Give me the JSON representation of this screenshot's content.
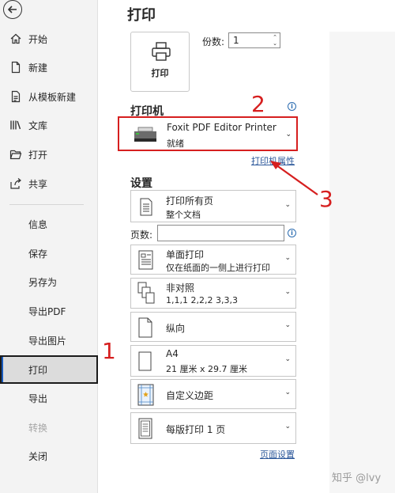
{
  "sidebar": {
    "items": [
      {
        "label": "开始",
        "icon": "home-icon"
      },
      {
        "label": "新建",
        "icon": "new-doc-icon"
      },
      {
        "label": "从模板新建",
        "icon": "template-icon"
      },
      {
        "label": "文库",
        "icon": "library-icon"
      },
      {
        "label": "打开",
        "icon": "folder-open-icon"
      },
      {
        "label": "共享",
        "icon": "share-icon"
      }
    ],
    "sub_items": [
      {
        "label": "信息"
      },
      {
        "label": "保存"
      },
      {
        "label": "另存为"
      },
      {
        "label": "导出PDF"
      },
      {
        "label": "导出图片"
      },
      {
        "label": "打印",
        "active": true
      },
      {
        "label": "导出"
      },
      {
        "label": "转换",
        "disabled": true
      },
      {
        "label": "关闭"
      }
    ]
  },
  "main": {
    "title": "打印",
    "print_button_label": "打印",
    "copies_label": "份数:",
    "copies_value": "1",
    "printer_section_title": "打印机",
    "printer_name": "Foxit PDF Editor Printer",
    "printer_status": "就绪",
    "printer_properties_link": "打印机属性",
    "settings_section_title": "设置",
    "pages_label": "页数:",
    "pages_value": "",
    "settings": [
      {
        "line1": "打印所有页",
        "line2": "整个文档",
        "icon": "pages-icon"
      },
      {
        "line1": "单面打印",
        "line2": "仅在纸面的一侧上进行打印",
        "icon": "single-sided-icon"
      },
      {
        "line1": "非对照",
        "line2": "1,1,1    2,2,2    3,3,3",
        "icon": "uncollated-icon"
      },
      {
        "line1": "纵向",
        "line2": "",
        "icon": "portrait-icon"
      },
      {
        "line1": "A4",
        "line2": "21 厘米 x 29.7 厘米",
        "icon": "paper-size-icon"
      },
      {
        "line1": "自定义边距",
        "line2": "",
        "icon": "margins-icon"
      },
      {
        "line1": "每版打印 1 页",
        "line2": "",
        "icon": "pages-per-sheet-icon"
      }
    ],
    "page_setup_link": "页面设置"
  },
  "annotations": {
    "n1": "1",
    "n2": "2",
    "n3": "3",
    "color": "#d61f1f"
  },
  "watermark": "知乎 @lvy"
}
